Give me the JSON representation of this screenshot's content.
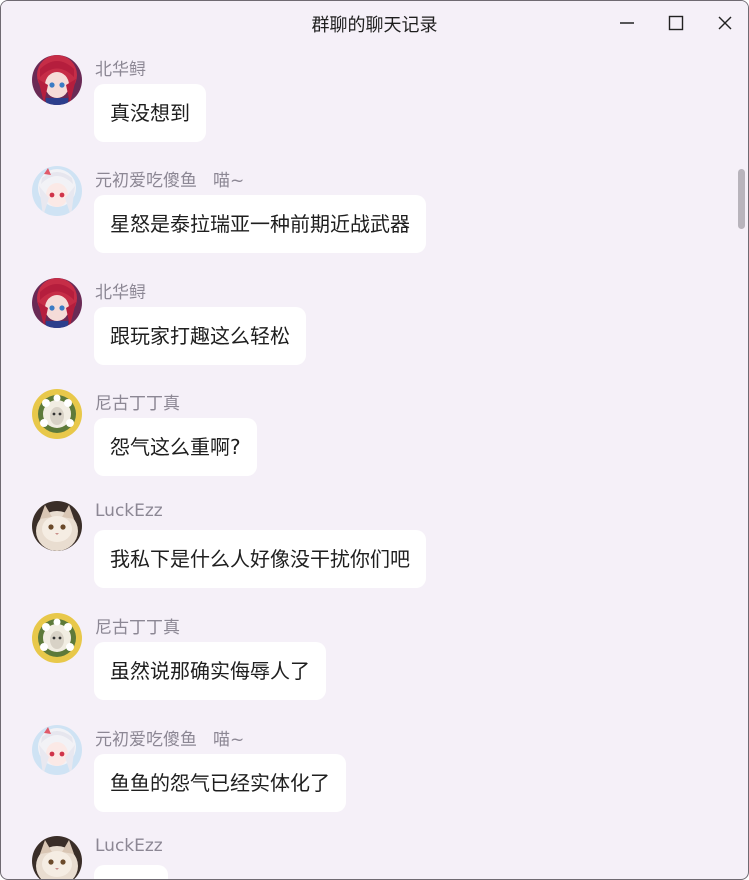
{
  "window": {
    "title": "群聊的聊天记录",
    "controls": {
      "minimize": "minimize-icon",
      "maximize": "maximize-icon",
      "close": "close-icon"
    }
  },
  "colors": {
    "background": "#f5f0f8",
    "bubble": "#ffffff",
    "name_text": "#8c8794",
    "message_text": "#1e1e1e"
  },
  "messages": [
    {
      "sender": "北华鲟",
      "badge": "",
      "text": "真没想到",
      "avatar": "red-haired-anime-girl"
    },
    {
      "sender": "元初爱吃傻鱼",
      "badge": "喵~",
      "text": "星怒是泰拉瑞亚一种前期近战武器",
      "avatar": "white-haired-anime-girl"
    },
    {
      "sender": "北华鲟",
      "badge": "",
      "text": "跟玩家打趣这么轻松",
      "avatar": "red-haired-anime-girl"
    },
    {
      "sender": "尼古丁丁真",
      "badge": "",
      "text": "怨气这么重啊?",
      "avatar": "flower-wreath-character"
    },
    {
      "sender": "LuckEzz",
      "badge": "",
      "text": "我私下是什么人好像没干扰你们吧",
      "avatar": "fluffy-cat"
    },
    {
      "sender": "尼古丁丁真",
      "badge": "",
      "text": "虽然说那确实侮辱人了",
      "avatar": "flower-wreath-character"
    },
    {
      "sender": "元初爱吃傻鱼",
      "badge": "喵~",
      "text": "鱼鱼的怨气已经实体化了",
      "avatar": "white-haired-anime-girl"
    },
    {
      "sender": "LuckEzz",
      "badge": "",
      "text": "",
      "avatar": "fluffy-cat"
    }
  ]
}
